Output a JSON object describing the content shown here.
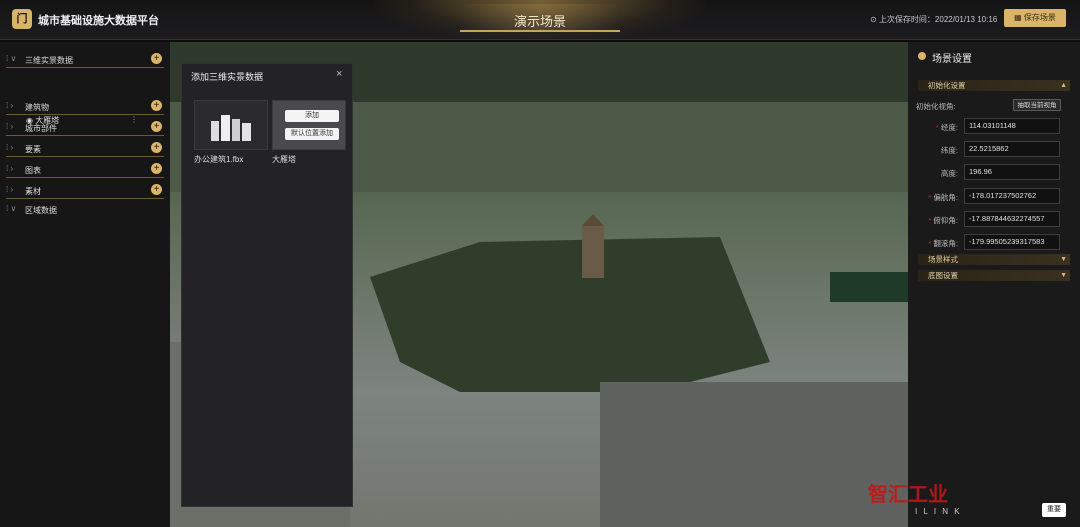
{
  "header": {
    "logo_text": "门",
    "app_title": "城市基础设施大数据平台",
    "page_title": "演示场景",
    "last_save": "上次保存时间：2022/01/13 10:16",
    "save_button": "保存场景"
  },
  "left_panel": {
    "items": [
      {
        "label": "三维实景数据",
        "expanded": true
      },
      {
        "label": "建筑物"
      },
      {
        "label": "城市部件"
      },
      {
        "label": "要素"
      },
      {
        "label": "图表"
      },
      {
        "label": "素材"
      },
      {
        "label": "区域数据",
        "expanded": true
      }
    ],
    "sub_item": "大雁塔",
    "sub_more": "⋮"
  },
  "modal": {
    "title": "添加三维实景数据",
    "close": "×",
    "cards": [
      {
        "label": "办公建筑1.fbx"
      },
      {
        "label": "大雁塔",
        "btn_add": "添加",
        "btn_default": "默认位置添加"
      }
    ]
  },
  "right_panel": {
    "title": "场景设置",
    "sections": {
      "init": "初始化设置",
      "style": "场景样式",
      "base": "底图设置"
    },
    "init_view_label": "初始化视角:",
    "capture_button": "抽取当前视角",
    "fields": [
      {
        "label": "经度:",
        "value": "114.03101148",
        "required": true
      },
      {
        "label": "纬度:",
        "value": "22.5215862",
        "required": false
      },
      {
        "label": "高度:",
        "value": "196.96",
        "required": false
      },
      {
        "label": "偏航角:",
        "value": "-178.017237502762",
        "required": true
      },
      {
        "label": "俯仰角:",
        "value": "-17.887844632274557",
        "required": true
      },
      {
        "label": "翻滚角:",
        "value": "-179.99505239317583",
        "required": true
      }
    ]
  },
  "watermark": {
    "brand": "智汇工业",
    "url": "I L I N K",
    "mini": "重要"
  }
}
